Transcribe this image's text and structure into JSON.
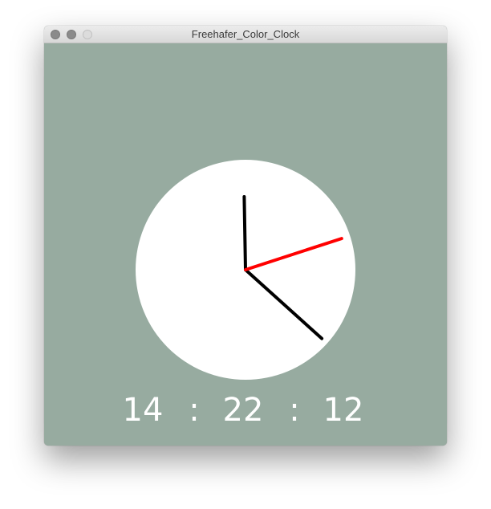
{
  "window": {
    "title": "Freehafer_Color_Clock"
  },
  "clock": {
    "hour_hand_icon": "hour-hand",
    "minute_hand_icon": "minute-hand",
    "second_hand_icon": "second-hand",
    "time": {
      "hours": "14",
      "minutes": "22",
      "seconds": "12",
      "separator": ":"
    },
    "hands_value": {
      "hour_angle_deg": 0,
      "minute_angle_deg": 132,
      "second_angle_deg": 72
    }
  },
  "colors": {
    "background": "#97aba0",
    "face": "#ffffff",
    "hand": "#000000",
    "second_hand": "#ff0000",
    "time_text": "#ffffff"
  }
}
